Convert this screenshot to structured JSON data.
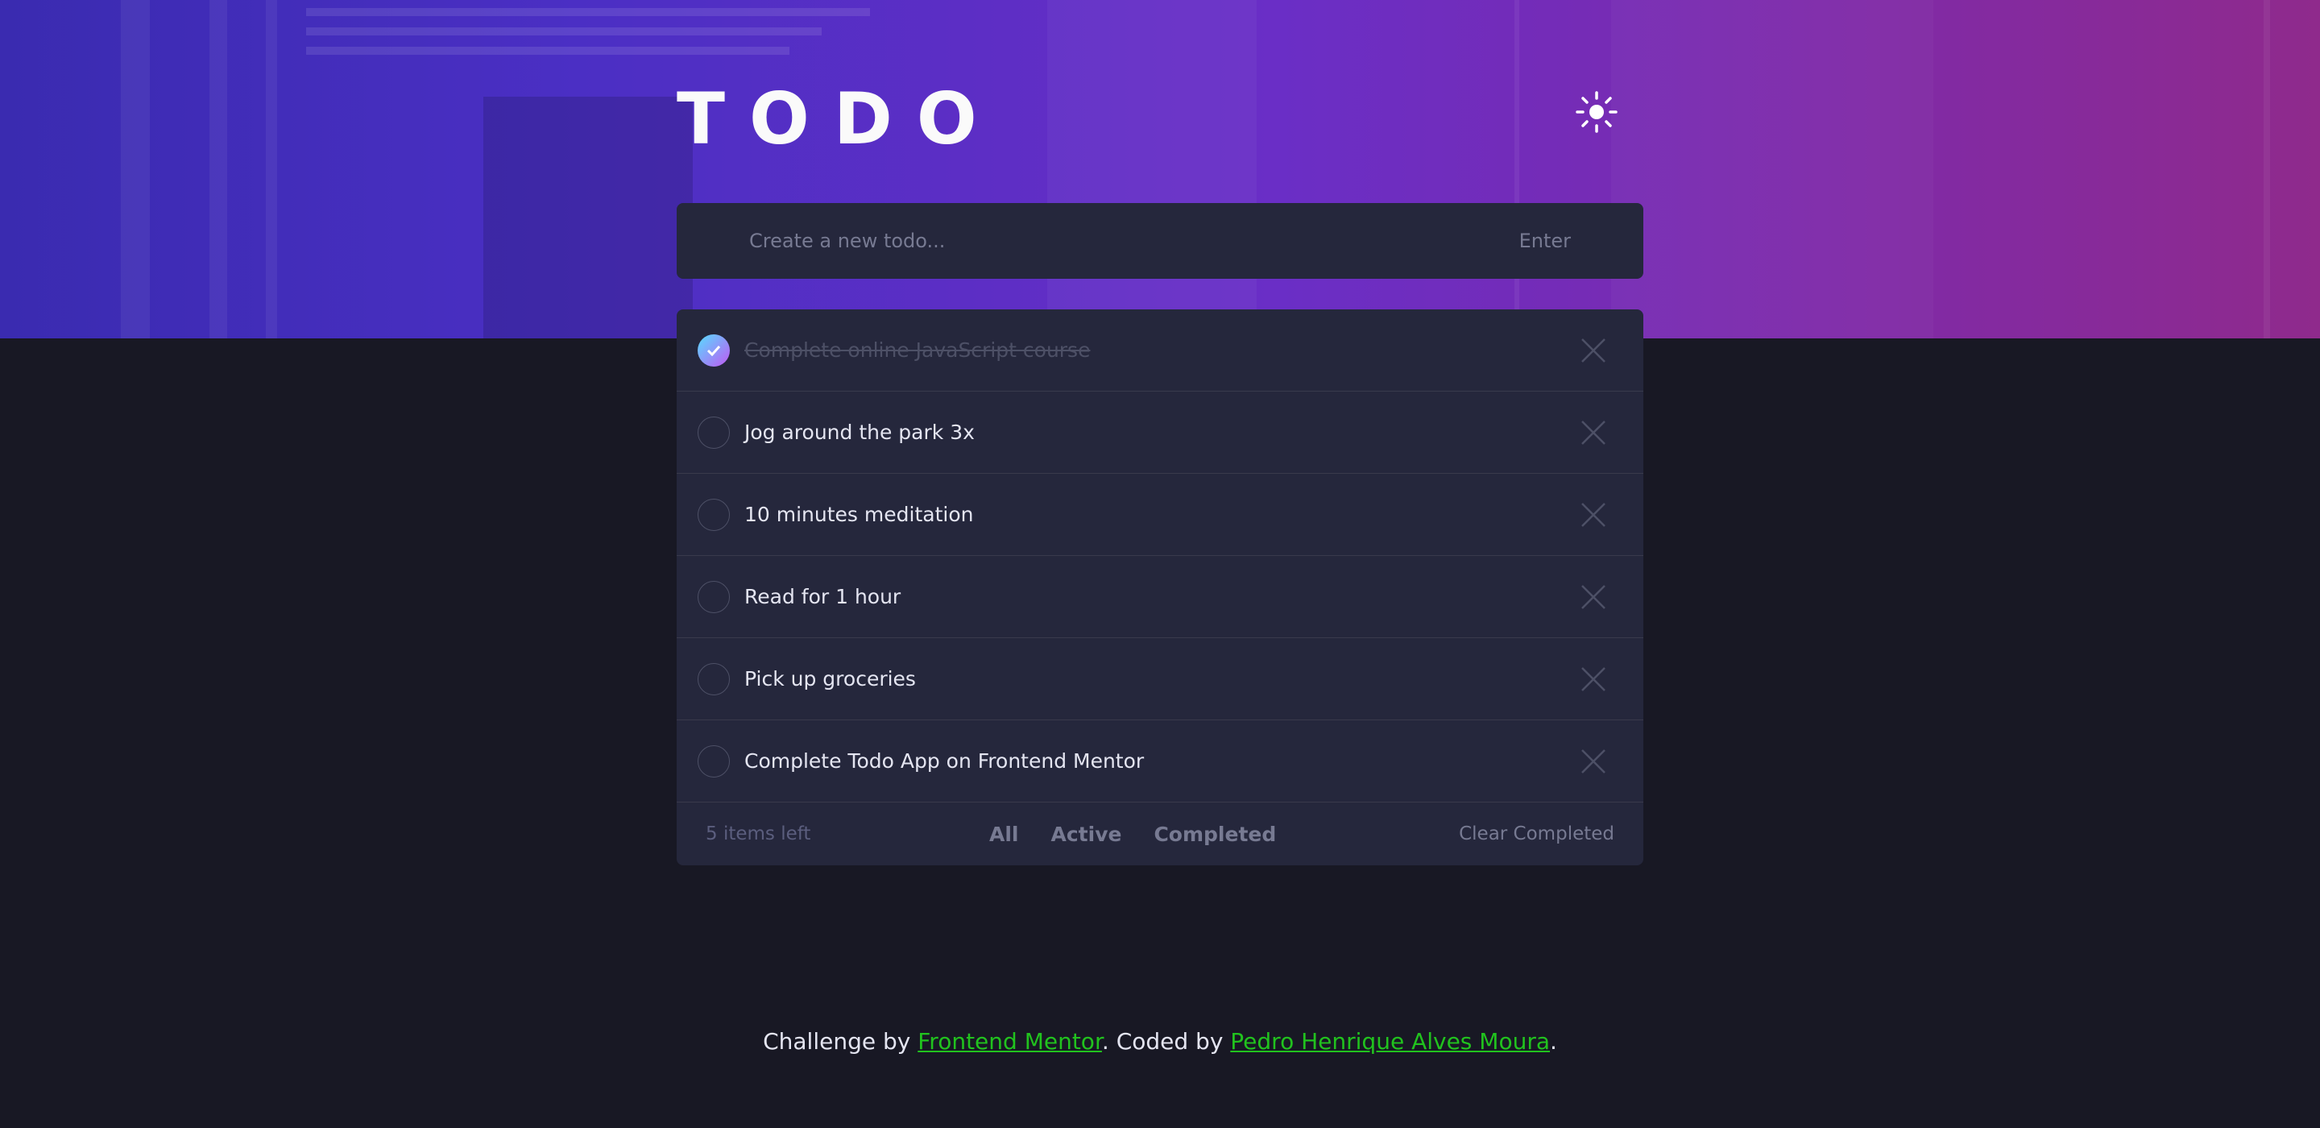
{
  "header": {
    "title": "TODO",
    "theme_icon": "sun-icon"
  },
  "new_todo": {
    "placeholder": "Create a new todo...",
    "enter_label": "Enter"
  },
  "todos": [
    {
      "text": "Complete online JavaScript course",
      "completed": true
    },
    {
      "text": "Jog around the park 3x",
      "completed": false
    },
    {
      "text": "10 minutes meditation",
      "completed": false
    },
    {
      "text": "Read for 1 hour",
      "completed": false
    },
    {
      "text": "Pick up groceries",
      "completed": false
    },
    {
      "text": "Complete Todo App on Frontend Mentor",
      "completed": false
    }
  ],
  "footer": {
    "items_left": "5 items left",
    "filters": [
      "All",
      "Active",
      "Completed"
    ],
    "clear_label": "Clear Completed"
  },
  "attribution": {
    "prefix": "Challenge by ",
    "link1": "Frontend Mentor",
    "middle": ". Coded by ",
    "link2": "Pedro Henrique Alves Moura",
    "suffix": "."
  },
  "colors": {
    "background": "#181824",
    "card": "#25273c",
    "link": "#21c21e",
    "check_gradient_start": "#57ddff",
    "check_gradient_end": "#c058f3"
  }
}
